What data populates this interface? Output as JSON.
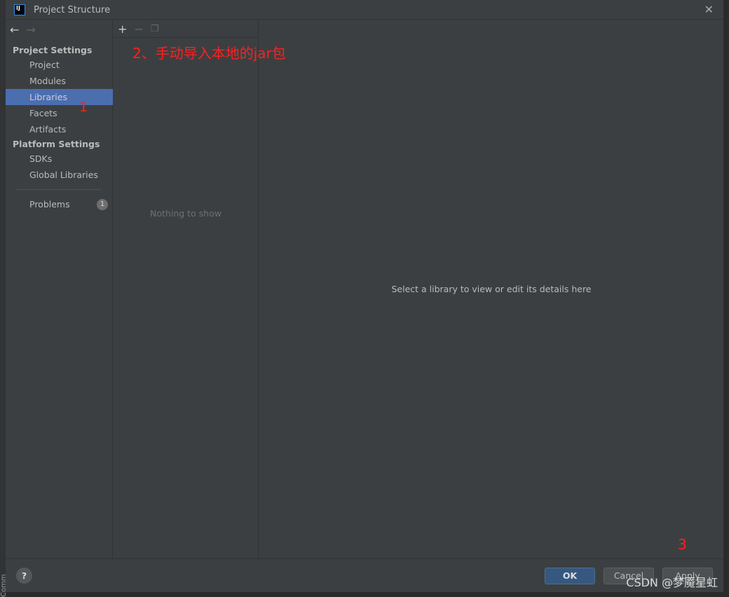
{
  "strip_text": "Comm",
  "window": {
    "title": "Project Structure",
    "logo": "IJ"
  },
  "sidebar": {
    "sections": [
      {
        "label": "Project Settings"
      },
      {
        "label": "Platform Settings"
      }
    ],
    "items": [
      {
        "label": "Project"
      },
      {
        "label": "Modules"
      },
      {
        "label": "Libraries",
        "selected": true
      },
      {
        "label": "Facets"
      },
      {
        "label": "Artifacts"
      },
      {
        "label": "SDKs"
      },
      {
        "label": "Global Libraries"
      },
      {
        "label": "Problems",
        "badge": "1"
      }
    ]
  },
  "middle": {
    "empty_text": "Nothing to show"
  },
  "details": {
    "hint": "Select a library to view or edit its details here"
  },
  "footer": {
    "help": "?",
    "ok": "OK",
    "cancel": "Cancel",
    "apply": "Apply"
  },
  "annotations": {
    "a1": "1",
    "a2": "2、手动导入本地的jar包",
    "a3": "3"
  },
  "watermark": "CSDN @梦魇星虹",
  "colors": {
    "selection": "#4b6eaf",
    "annotation": "#ff2020"
  }
}
